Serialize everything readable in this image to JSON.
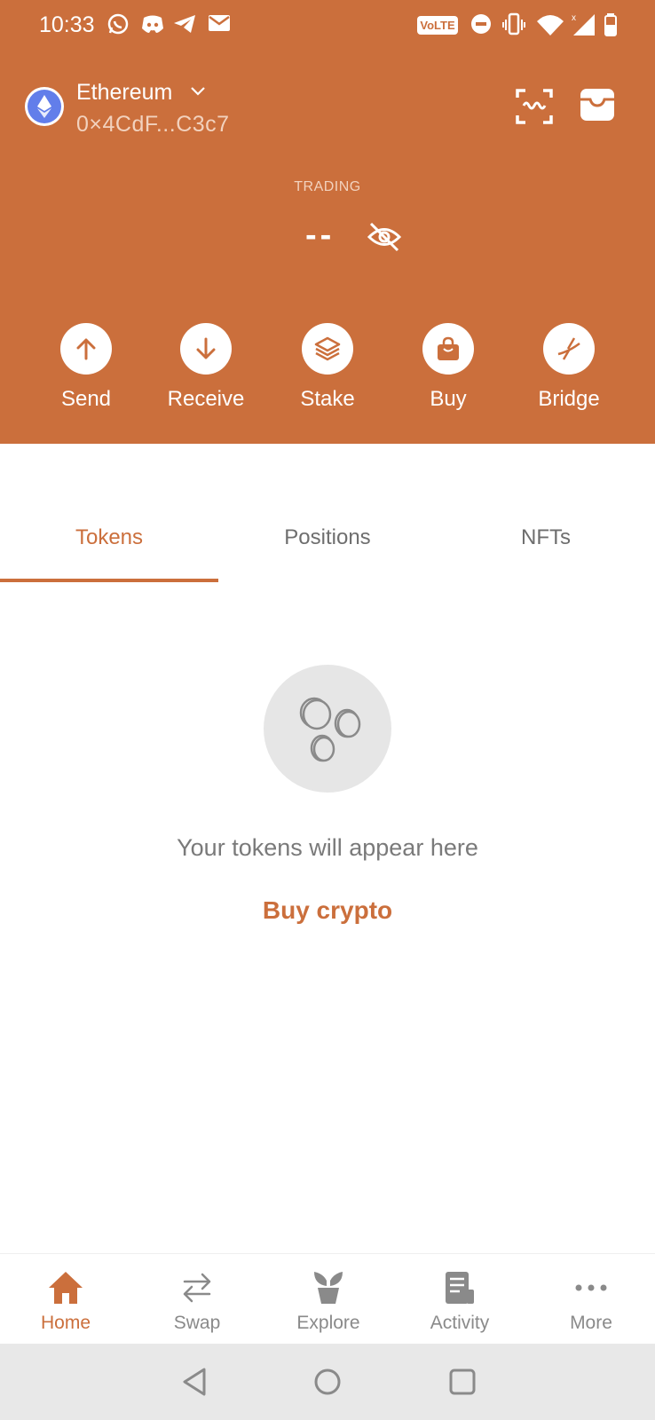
{
  "status_bar": {
    "time": "10:33",
    "volte": "VoLTE",
    "icons": [
      "whatsapp-icon",
      "discord-icon",
      "telegram-icon",
      "mail-icon",
      "dnd-icon",
      "vibrate-icon",
      "wifi-icon",
      "signal-icon",
      "battery-icon"
    ]
  },
  "account": {
    "network": "Ethereum",
    "address": "0×4CdF...C3c7",
    "network_icon": "ethereum-logo"
  },
  "header_icons": [
    "scan-icon",
    "inbox-icon"
  ],
  "balance": {
    "label": "TRADING",
    "value": "--",
    "visibility_icon": "eye-off-icon"
  },
  "actions": [
    {
      "label": "Send",
      "icon": "arrow-up-icon"
    },
    {
      "label": "Receive",
      "icon": "arrow-down-icon"
    },
    {
      "label": "Stake",
      "icon": "layers-icon"
    },
    {
      "label": "Buy",
      "icon": "shopping-bag-icon"
    },
    {
      "label": "Bridge",
      "icon": "bridge-icon"
    }
  ],
  "tabs": [
    {
      "label": "Tokens",
      "active": true
    },
    {
      "label": "Positions",
      "active": false
    },
    {
      "label": "NFTs",
      "active": false
    }
  ],
  "empty_state": {
    "icon": "coins-icon",
    "message": "Your tokens will appear here",
    "cta": "Buy crypto"
  },
  "bottom_nav": [
    {
      "label": "Home",
      "icon": "home-icon",
      "active": true
    },
    {
      "label": "Swap",
      "icon": "swap-icon",
      "active": false
    },
    {
      "label": "Explore",
      "icon": "plant-icon",
      "active": false
    },
    {
      "label": "Activity",
      "icon": "receipt-icon",
      "active": false
    },
    {
      "label": "More",
      "icon": "more-dots-icon",
      "active": false
    }
  ],
  "colors": {
    "accent": "#CB6F3C",
    "header_bg": "#CB6F3C",
    "muted_text": "#7A7A7A",
    "ethereum": "#627EEA"
  }
}
